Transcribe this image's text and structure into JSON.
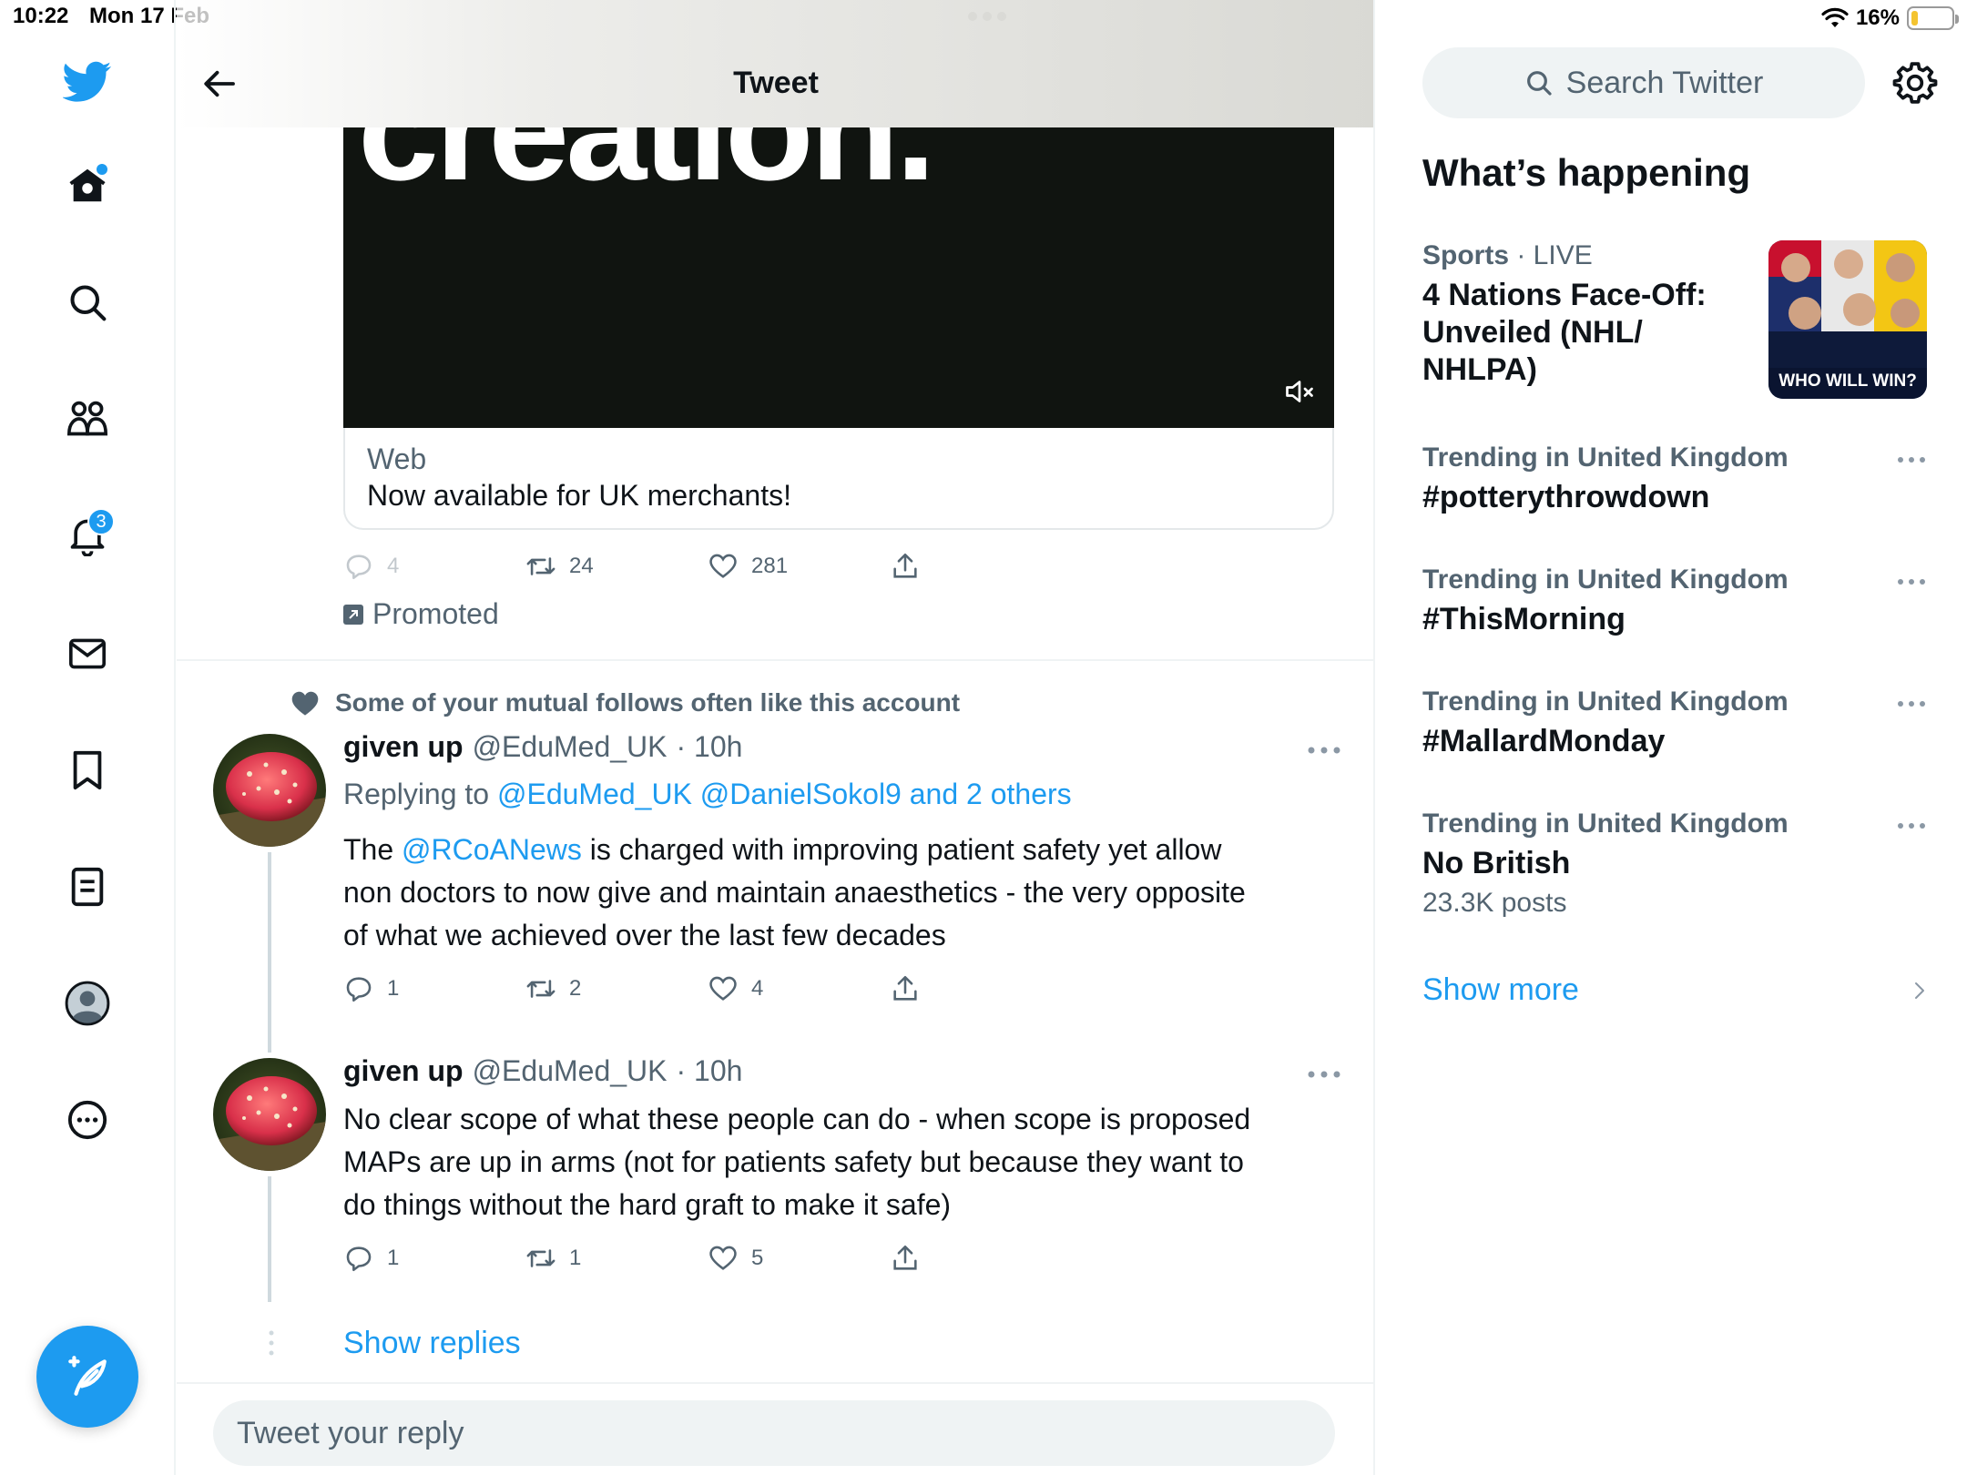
{
  "status_bar": {
    "time": "10:22",
    "date": "Mon 17 Feb",
    "battery": "16%",
    "battery_level": 0.16
  },
  "nav": {
    "notifications_badge": "3"
  },
  "header": {
    "title": "Tweet"
  },
  "promoted_tweet": {
    "media_text": "creation.",
    "card_domain": "Web",
    "card_title": "Now available for UK merchants!",
    "replies": "4",
    "retweets": "24",
    "likes": "281",
    "promoted_label": "Promoted"
  },
  "social_context": "Some of your mutual follows often like this account",
  "thread": [
    {
      "name": "given up",
      "handle": "@EduMed_UK",
      "time": "· 10h",
      "replying_prefix": "Replying to",
      "replying_to": "@EduMed_UK @DanielSokol9 and 2 others",
      "body_pre": "The",
      "body_mention": "@RCoANews",
      "body_post": "is charged with improving patient safety yet allow non doctors to now give and maintain anaesthetics - the very opposite of what we achieved over the last few  decades",
      "replies": "1",
      "retweets": "2",
      "likes": "4"
    },
    {
      "name": "given up",
      "handle": "@EduMed_UK",
      "time": "· 10h",
      "body": "No clear scope of what these people can do - when scope is proposed MAPs are up in arms (not for patients safety but because they want to do things without the hard graft to make it safe)",
      "replies": "1",
      "retweets": "1",
      "likes": "5"
    }
  ],
  "show_replies": "Show replies",
  "reply_placeholder": "Tweet your reply",
  "sidebar": {
    "search_placeholder": "Search Twitter",
    "section_title": "What’s happening",
    "featured": {
      "category": "Sports",
      "live": "· LIVE",
      "title": "4 Nations Face-Off: Unveiled (NHL/ NHLPA)",
      "image_caption": "WHO WILL WIN?"
    },
    "trends": [
      {
        "category": "Trending in United Kingdom",
        "title": "#potterythrowdown",
        "posts": ""
      },
      {
        "category": "Trending in United Kingdom",
        "title": "#ThisMorning",
        "posts": ""
      },
      {
        "category": "Trending in United Kingdom",
        "title": "#MallardMonday",
        "posts": ""
      },
      {
        "category": "Trending in United Kingdom",
        "title": "No British",
        "posts": "23.3K posts"
      }
    ],
    "show_more": "Show more"
  },
  "colors": {
    "accent": "#1d9bf0",
    "text": "#0f1419",
    "secondary": "#536471",
    "border": "#eff3f4"
  }
}
